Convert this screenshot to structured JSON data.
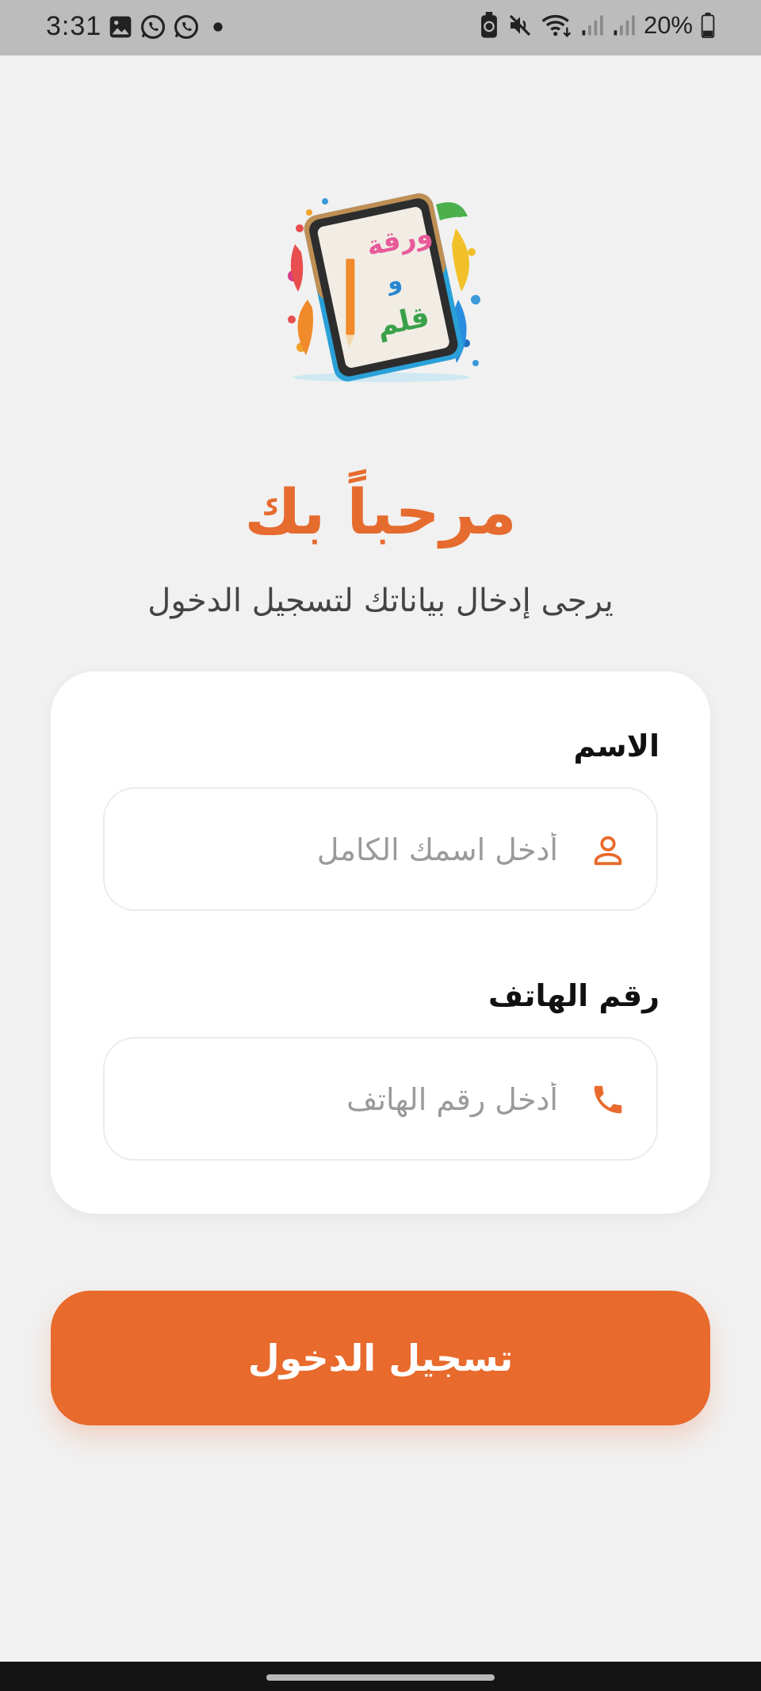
{
  "status_bar": {
    "time": "3:31",
    "left_icons": [
      "gallery-icon",
      "whatsapp-icon",
      "whatsapp-icon",
      "dot-icon"
    ],
    "right_icons": [
      "data-saver-icon",
      "mute-icon",
      "wifi-icon",
      "signal-icon",
      "signal-icon"
    ],
    "battery": "20%"
  },
  "logo": {
    "text_line1": "ورقة",
    "text_line2": "و",
    "text_line3": "قلم"
  },
  "header": {
    "title": "مرحباً بك",
    "subtitle": "يرجى إدخال بياناتك لتسجيل الدخول"
  },
  "form": {
    "name": {
      "label": "الاسم",
      "placeholder": "أدخل اسمك الكامل",
      "value": "",
      "icon": "person-icon"
    },
    "phone": {
      "label": "رقم الهاتف",
      "placeholder": "أدخل رقم الهاتف",
      "value": "",
      "icon": "phone-icon"
    }
  },
  "login_button": {
    "label": "تسجيل الدخول"
  },
  "colors": {
    "accent": "#e86a2c",
    "background": "#f1f1f1",
    "card": "#ffffff"
  }
}
